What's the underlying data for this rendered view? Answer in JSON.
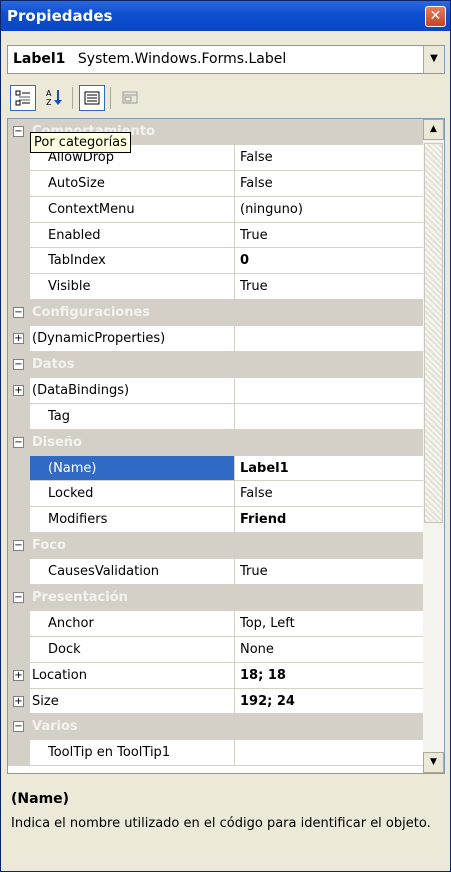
{
  "window": {
    "title": "Propiedades",
    "close_glyph": "✕"
  },
  "object_selector": {
    "name": "Label1",
    "type": "System.Windows.Forms.Label",
    "arrow_glyph": "▼"
  },
  "toolbar": {
    "buttons": [
      {
        "name": "categorized-icon",
        "tooltip": "Por categorías",
        "pressed": true
      },
      {
        "name": "alphabetical-icon",
        "pressed": false
      },
      {
        "name": "properties-icon",
        "pressed": true
      },
      {
        "name": "property-pages-icon",
        "pressed": false
      }
    ]
  },
  "tooltip": {
    "text": "Por categorías"
  },
  "grid": {
    "rows": [
      {
        "kind": "category",
        "name": "Comportamiento",
        "toggle": "−"
      },
      {
        "kind": "property",
        "name": "AllowDrop",
        "value": "False"
      },
      {
        "kind": "property",
        "name": "AutoSize",
        "value": "False"
      },
      {
        "kind": "property",
        "name": "ContextMenu",
        "value": "(ninguno)"
      },
      {
        "kind": "property",
        "name": "Enabled",
        "value": "True"
      },
      {
        "kind": "property",
        "name": "TabIndex",
        "value": "0",
        "bold": true
      },
      {
        "kind": "property",
        "name": "Visible",
        "value": "True"
      },
      {
        "kind": "category",
        "name": "Configuraciones",
        "toggle": "−"
      },
      {
        "kind": "expandable",
        "name": "(DynamicProperties)",
        "value": "",
        "toggle": "+"
      },
      {
        "kind": "category",
        "name": "Datos",
        "toggle": "−"
      },
      {
        "kind": "expandable",
        "name": "(DataBindings)",
        "value": "",
        "toggle": "+"
      },
      {
        "kind": "property",
        "name": "Tag",
        "value": ""
      },
      {
        "kind": "category",
        "name": "Diseño",
        "toggle": "−"
      },
      {
        "kind": "property",
        "name": "(Name)",
        "value": "Label1",
        "bold": true,
        "selected": true
      },
      {
        "kind": "property",
        "name": "Locked",
        "value": "False"
      },
      {
        "kind": "property",
        "name": "Modifiers",
        "value": "Friend",
        "bold": true
      },
      {
        "kind": "category",
        "name": "Foco",
        "toggle": "−"
      },
      {
        "kind": "property",
        "name": "CausesValidation",
        "value": "True"
      },
      {
        "kind": "category",
        "name": "Presentación",
        "toggle": "−"
      },
      {
        "kind": "property",
        "name": "Anchor",
        "value": "Top, Left"
      },
      {
        "kind": "property",
        "name": "Dock",
        "value": "None"
      },
      {
        "kind": "expandable",
        "name": "Location",
        "value": "18; 18",
        "bold": true,
        "toggle": "+"
      },
      {
        "kind": "expandable",
        "name": "Size",
        "value": "192; 24",
        "bold": true,
        "toggle": "+"
      },
      {
        "kind": "category",
        "name": "Varios",
        "toggle": "−"
      },
      {
        "kind": "property",
        "name": "ToolTip en ToolTip1",
        "value": ""
      }
    ]
  },
  "scrollbar": {
    "up_glyph": "▲",
    "down_glyph": "▼"
  },
  "description": {
    "title": "(Name)",
    "text": "Indica el nombre utilizado en el código para identificar el objeto."
  }
}
